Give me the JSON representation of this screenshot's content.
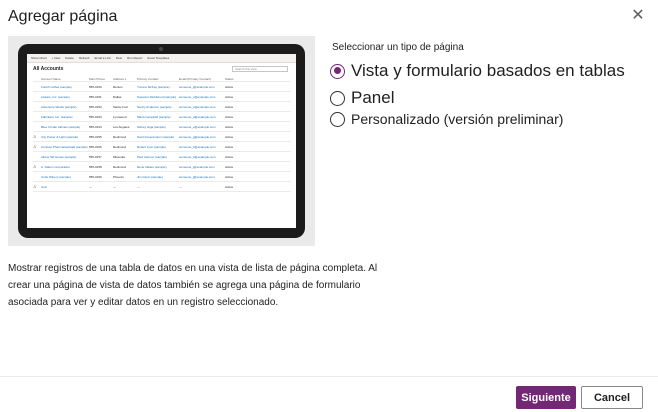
{
  "dialog": {
    "title": "Agregar página",
    "close_glyph": "✕",
    "options_label": "Seleccionar un tipo de página",
    "options": [
      {
        "label": "Vista y formulario basados en tablas",
        "selected": true
      },
      {
        "label": "Panel",
        "selected": false
      },
      {
        "label": "Personalizado (versión preliminar)",
        "selected": false
      }
    ],
    "description": "Mostrar registros de una tabla de datos en una vista de lista de página completa. Al crear una página de vista de datos también se agrega una página de formulario asociada para ver y editar datos en un registro seleccionado.",
    "next_label": "Siguiente",
    "cancel_label": "Cancel",
    "accent_color": "#742774"
  },
  "preview": {
    "commands": [
      "Show Chart",
      "+ New",
      "Delete",
      "Refresh",
      "Email a Link",
      "Flow",
      "Run Report",
      "Excel Templates"
    ],
    "view_title": "All Accounts",
    "search_placeholder": "Search this view",
    "columns": [
      "Account Name",
      "Main Phone",
      "Address 1",
      "Primary Contact",
      "Email (Primary Contact)",
      "Status"
    ],
    "rows": [
      {
        "icon": "",
        "cells": [
          "Fourth Coffee (sample)",
          "555-0150",
          "Renton",
          "Yvonne McKay (sample)",
          "someone_i@example.com",
          "Active"
        ]
      },
      {
        "icon": "",
        "cells": [
          "Litware, Inc. (sample)",
          "555-0151",
          "Dallas",
          "Susanna Stubberod (sample)",
          "someone_c@example.com",
          "Active"
        ]
      },
      {
        "icon": "",
        "cells": [
          "Adventure Works (sample)",
          "555-0152",
          "Santa Cruz",
          "Nancy Anderson (sample)",
          "someone_c@example.com",
          "Active"
        ]
      },
      {
        "icon": "",
        "cells": [
          "Fabrikam, Inc. (sample)",
          "555-0153",
          "Lynnwood",
          "Maria Campbell (sample)",
          "someone_d@example.com",
          "Active"
        ]
      },
      {
        "icon": "",
        "cells": [
          "Blue Yonder Airlines (sample)",
          "555-0154",
          "Los Angeles",
          "Sidney Higa (sample)",
          "someone_e@example.com",
          "Active"
        ]
      },
      {
        "icon": "♙",
        "cells": [
          "City Power & Light (sample)",
          "555-0155",
          "Redmond",
          "Scott Konersmann (sample)",
          "someone_g@example.com",
          "Active"
        ]
      },
      {
        "icon": "♙",
        "cells": [
          "Contoso Pharmaceuticals (sample)",
          "555-0156",
          "Redmond",
          "Robert Lyon (sample)",
          "someone_h@example.com",
          "Active"
        ]
      },
      {
        "icon": "",
        "cells": [
          "Alpine Ski House (sample)",
          "555-0157",
          "Missoula",
          "Paul Cannon (sample)",
          "someone_h@example.com",
          "Active"
        ]
      },
      {
        "icon": "♙",
        "cells": [
          "A. Datum Corporation",
          "555-0158",
          "Redmond",
          "Rene Valdes (sample)",
          "someone_i@example.com",
          "Active"
        ]
      },
      {
        "icon": "",
        "cells": [
          "Coho Winery (sample)",
          "555-0159",
          "Phoenix",
          "Jim Glynn (sample)",
          "someone_j@example.com",
          "Active"
        ]
      },
      {
        "icon": "♙",
        "cells": [
          "Ixxxi",
          "---",
          "---",
          "---",
          "---",
          "Active"
        ]
      }
    ]
  }
}
